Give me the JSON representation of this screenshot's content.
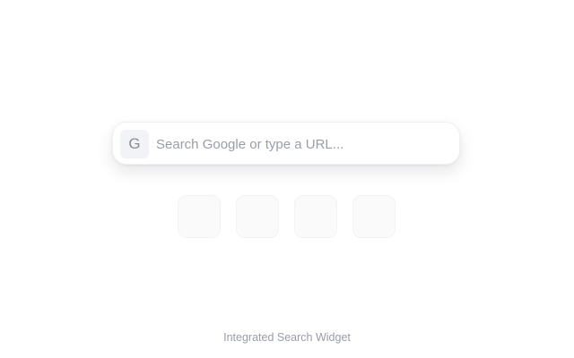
{
  "search": {
    "engine_letter": "G",
    "placeholder": "Search Google or type a URL...",
    "value": ""
  },
  "shortcuts": [
    {
      "label": ""
    },
    {
      "label": ""
    },
    {
      "label": ""
    },
    {
      "label": ""
    }
  ],
  "footer": {
    "caption": "Integrated Search Widget"
  },
  "colors": {
    "background": "#ffffff",
    "badge_bg": "#f2f3f6",
    "placeholder_text": "#9a9da9",
    "shortcut_bg": "#fafafa"
  },
  "icons": {
    "engine": "google-g-icon"
  }
}
